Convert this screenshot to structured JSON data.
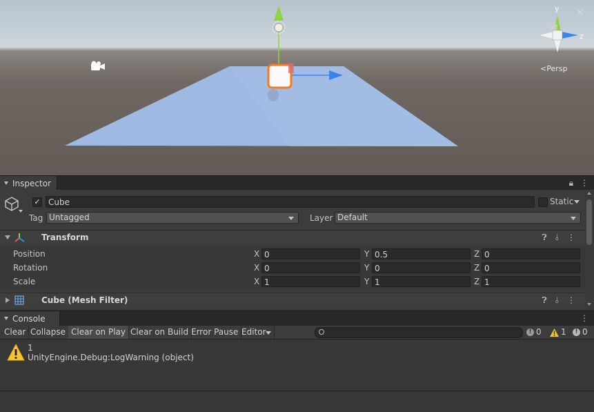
{
  "scene": {
    "view_mode_label": "<Persp",
    "gizmo_axes": {
      "y": "y",
      "z": "z"
    },
    "colors": {
      "plane": "#9fb9e2",
      "selection_outline": "#f47a20",
      "y_axis": "#8fd43a",
      "z_axis": "#3b84f0"
    }
  },
  "inspector": {
    "tab_label": "Inspector",
    "object_name": "Cube",
    "static_label": "Static",
    "tag_label": "Tag",
    "tag_value": "Untagged",
    "layer_label": "Layer",
    "layer_value": "Default",
    "transform": {
      "title": "Transform",
      "rows": [
        {
          "label": "Position",
          "x": "0",
          "y": "0.5",
          "z": "0"
        },
        {
          "label": "Rotation",
          "x": "0",
          "y": "0",
          "z": "0"
        },
        {
          "label": "Scale",
          "x": "1",
          "y": "1",
          "z": "1"
        }
      ],
      "axis_labels": {
        "x": "X",
        "y": "Y",
        "z": "Z"
      }
    },
    "mesh_filter": {
      "title": "Cube (Mesh Filter)"
    }
  },
  "console": {
    "tab_label": "Console",
    "toolbar": [
      "Clear",
      "Collapse",
      "Clear on Play",
      "Clear on Build",
      "Error Pause",
      "Editor"
    ],
    "counts": {
      "info": "0",
      "warning": "1",
      "error": "0"
    },
    "log": {
      "line1": "1",
      "line2": "UnityEngine.Debug:LogWarning (object)"
    }
  }
}
